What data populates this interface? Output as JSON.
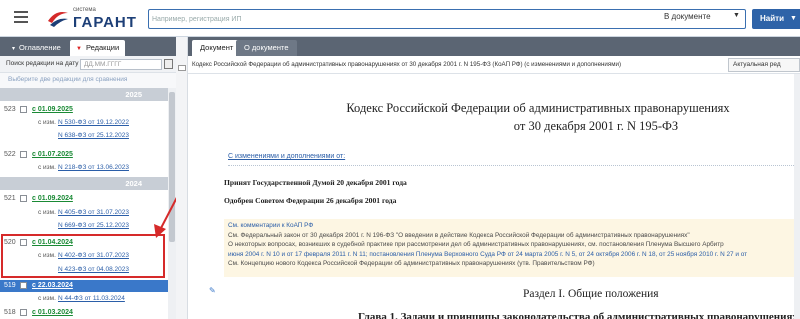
{
  "header": {
    "logo_small": "система",
    "logo_big": "ГАРАНТ",
    "search_placeholder": "Например, регистрация ИП",
    "scope": "В документе",
    "find_button": "Найти"
  },
  "left_panel": {
    "tabs": [
      {
        "label": "Оглавление"
      },
      {
        "label": "Редакции"
      }
    ],
    "date_search_label": "Поиск редакции на дату",
    "date_placeholder": "ДД.ММ.ГГГГ",
    "pick_hint": "Выберите две редакции для сравнения",
    "year_2025": "2025",
    "year_2024": "2024",
    "editions": [
      {
        "num": "523",
        "date": "с 01.09.2025",
        "changes": [
          {
            "prefix": "с изм.",
            "link": "N 530-ФЗ от 19.12.2022"
          },
          {
            "prefix": "",
            "link": "N 638-ФЗ от 25.12.2023"
          }
        ]
      },
      {
        "num": "522",
        "date": "с 01.07.2025",
        "changes": [
          {
            "prefix": "с изм.",
            "link": "N 218-ФЗ от 13.06.2023"
          }
        ]
      },
      {
        "num": "521",
        "date": "с 01.09.2024",
        "changes": [
          {
            "prefix": "с изм.",
            "link": "N 405-ФЗ от 31.07.2023"
          },
          {
            "prefix": "",
            "link": "N 669-ФЗ от 25.12.2023"
          }
        ]
      },
      {
        "num": "520",
        "date": "с 01.04.2024",
        "changes": [
          {
            "prefix": "с изм.",
            "link": "N 402-ФЗ от 31.07.2023"
          },
          {
            "prefix": "",
            "link": "N 423-ФЗ от 04.08.2023"
          }
        ]
      },
      {
        "num": "519",
        "date": "с 22.03.2024",
        "changes": [
          {
            "prefix": "с изм.",
            "link": "N 44-ФЗ от 11.03.2024"
          }
        ]
      },
      {
        "num": "518",
        "date": "с 01.03.2024",
        "changes": []
      }
    ]
  },
  "right_panel": {
    "tabs": [
      {
        "label": "Документ"
      },
      {
        "label": "О документе"
      }
    ],
    "doc_title_bar": "Кодекс Российской Федерации об административных правонарушениях от 30 декабря 2001 г. N 195-ФЗ (КоАП РФ) (с изменениями и дополнениями)",
    "actual_edition": "Актуальная ред",
    "title_line1": "Кодекс Российской Федерации об административных правонарушениях",
    "title_line2": "от 30 декабря 2001 г. N 195-ФЗ",
    "changes_link": "С изменениями и дополнениями от:",
    "adopted": "Принят Государственной Думой 20 декабря 2001 года",
    "approved": "Одобрен Советом Федерации 26 декабря 2001 года",
    "note_lines": [
      {
        "text": "См. комментарии к КоАП РФ"
      },
      {
        "text": "См. Федеральный закон от 30 декабря 2001 г. N 196-ФЗ \"О введении в действие Кодекса Российской Федерации об административных правонарушениях\""
      },
      {
        "text": "О некоторых вопросах, возникших в судебной практике при рассмотрении дел об административных правонарушениях, см. постановления Пленума Высшего Арбитр"
      },
      {
        "text": "июня 2004 г. N 10 и от 17 февраля 2011 г. N 11; постановления Пленума Верховного Суда РФ от 24 марта 2005 г. N 5, от 24 октября 2006 г. N 18, от 25 ноября 2010 г. N 27 и от"
      },
      {
        "text": "См. Концепцию нового Кодекса Российской Федерации об административных правонарушениях (утв. Правительством РФ)"
      }
    ],
    "section_title": "Раздел I. Общие положения",
    "chapter_title": "Глава 1. Задачи и принципы законодательства об административных правонарушениях"
  }
}
